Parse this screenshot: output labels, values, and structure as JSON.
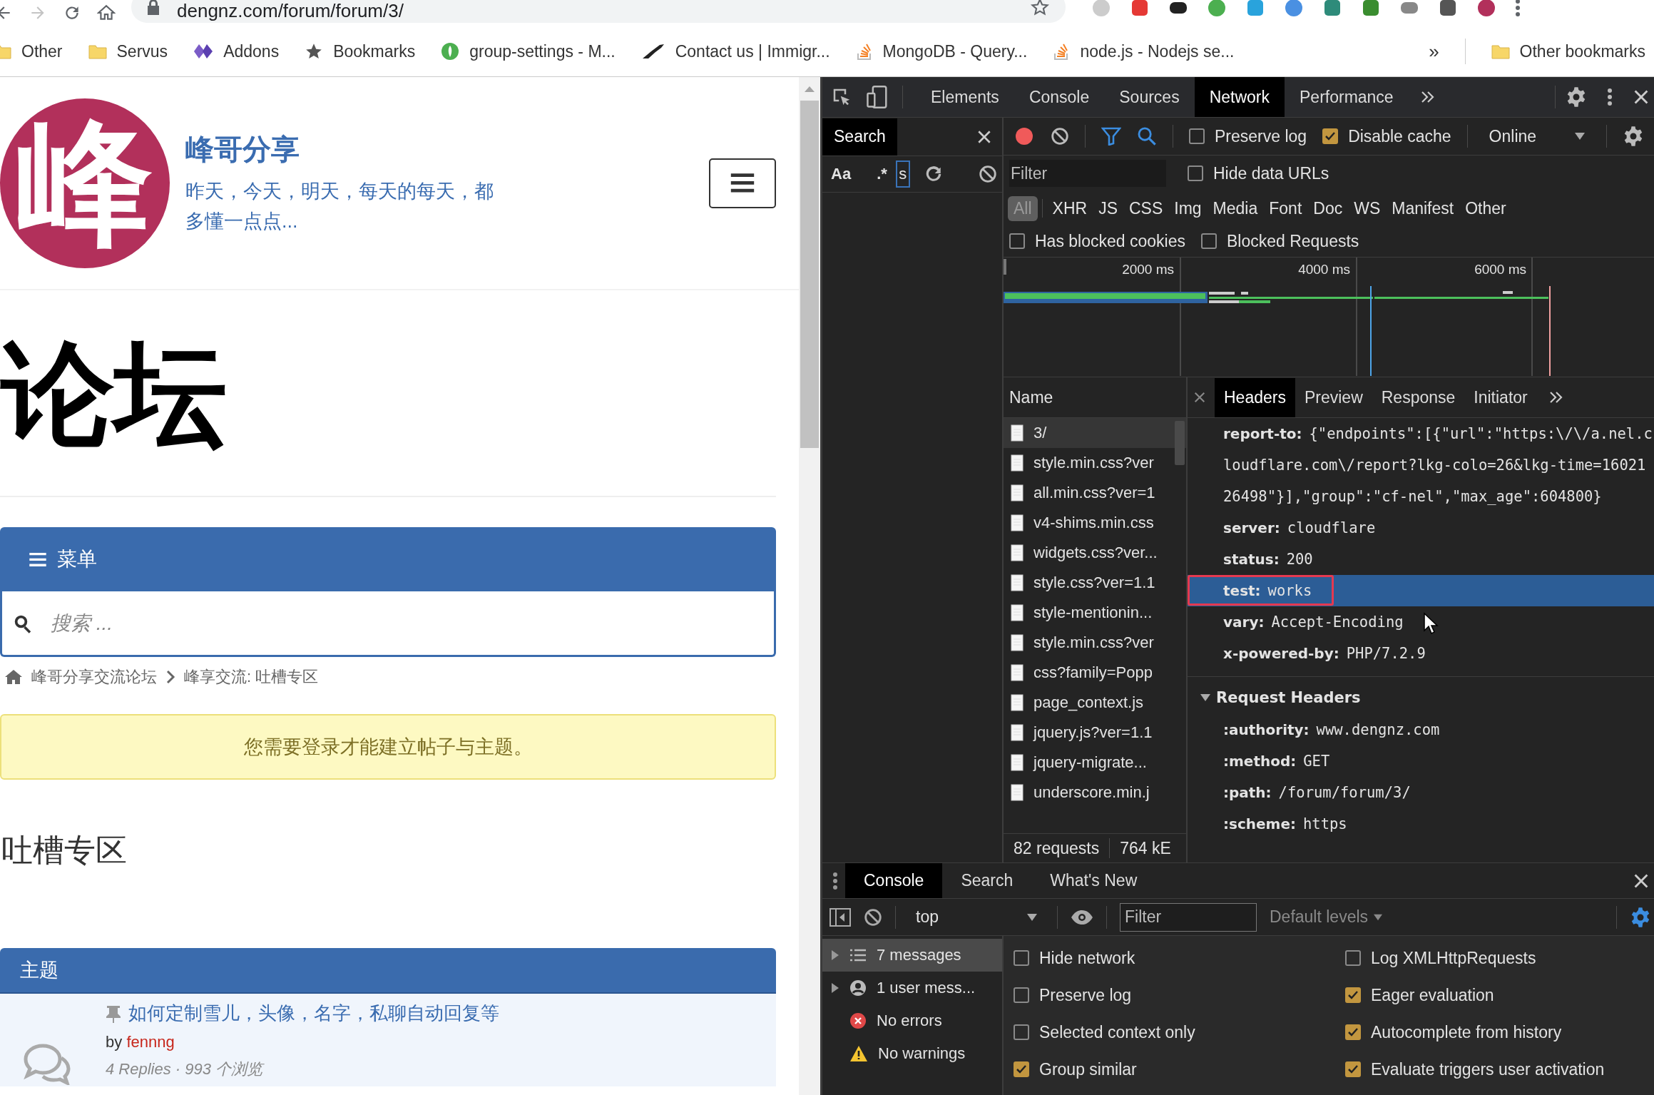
{
  "browser": {
    "url": "dengnz.com/forum/forum/3/",
    "bookmarks": [
      {
        "label": "Other"
      },
      {
        "label": "Servus"
      },
      {
        "label": "Addons"
      },
      {
        "label": "Bookmarks"
      },
      {
        "label": "group-settings - M..."
      },
      {
        "label": "Contact us | Immigr..."
      },
      {
        "label": "MongoDB - Query..."
      },
      {
        "label": "node.js - Nodejs se..."
      }
    ],
    "more": "»",
    "other_bookmarks": "Other bookmarks"
  },
  "page": {
    "logo": "峰",
    "site_title": "峰哥分享",
    "tagline": "昨天，今天，明天，每天的每天，都多懂一点点...",
    "heading": "论坛",
    "menu_label": "菜单",
    "search_placeholder": "搜索 ...",
    "breadcrumbs": [
      "峰哥分享交流论坛",
      "峰享交流: 吐槽专区"
    ],
    "notice": "您需要登录才能建立帖子与主题。",
    "forum_title": "吐槽专区",
    "topics_header": "主题",
    "topics": [
      {
        "title": "如何定制雪儿，头像，名字，私聊自动回复等",
        "pinned": true,
        "by": "by",
        "author": "fennng",
        "meta": "4 Replies · 993 个浏览"
      }
    ]
  },
  "devtools": {
    "tabs": [
      {
        "label": "Elements",
        "selected": false
      },
      {
        "label": "Console",
        "selected": false
      },
      {
        "label": "Sources",
        "selected": false
      },
      {
        "label": "Network",
        "selected": true
      },
      {
        "label": "Performance",
        "selected": false
      }
    ],
    "search_panel": {
      "title": "Search",
      "match_case": "Aa",
      "regex": ".*",
      "query": "s"
    },
    "network": {
      "preserve_log": false,
      "preserve_log_label": "Preserve log",
      "disable_cache": true,
      "disable_cache_label": "Disable cache",
      "throttle": "Online",
      "filter_placeholder": "Filter",
      "hide_data_urls": false,
      "hide_data_urls_label": "Hide data URLs",
      "types": [
        {
          "label": "All",
          "selected": true
        },
        {
          "label": "XHR",
          "selected": false
        },
        {
          "label": "JS",
          "selected": false
        },
        {
          "label": "CSS",
          "selected": false
        },
        {
          "label": "Img",
          "selected": false
        },
        {
          "label": "Media",
          "selected": false
        },
        {
          "label": "Font",
          "selected": false
        },
        {
          "label": "Doc",
          "selected": false
        },
        {
          "label": "WS",
          "selected": false
        },
        {
          "label": "Manifest",
          "selected": false
        },
        {
          "label": "Other",
          "selected": false
        }
      ],
      "has_blocked_cookies": false,
      "has_blocked_cookies_label": "Has blocked cookies",
      "blocked_requests": false,
      "blocked_requests_label": "Blocked Requests",
      "timeline_ticks": [
        "2000 ms",
        "4000 ms",
        "6000 ms"
      ],
      "requests_header": "Name",
      "requests": [
        {
          "name": "3/",
          "selected": true
        },
        {
          "name": "style.min.css?ver",
          "selected": false
        },
        {
          "name": "all.min.css?ver=1",
          "selected": false
        },
        {
          "name": "v4-shims.min.css",
          "selected": false
        },
        {
          "name": "widgets.css?ver...",
          "selected": false
        },
        {
          "name": "style.css?ver=1.1",
          "selected": false
        },
        {
          "name": "style-mentionin...",
          "selected": false
        },
        {
          "name": "style.min.css?ver",
          "selected": false
        },
        {
          "name": "css?family=Popp",
          "selected": false
        },
        {
          "name": "page_context.js",
          "selected": false
        },
        {
          "name": "jquery.js?ver=1.1",
          "selected": false
        },
        {
          "name": "jquery-migrate...",
          "selected": false
        },
        {
          "name": "underscore.min.j",
          "selected": false
        }
      ],
      "summary": [
        "82 requests",
        "764 kE"
      ],
      "detail_tabs": [
        {
          "label": "Headers",
          "selected": true
        },
        {
          "label": "Preview",
          "selected": false
        },
        {
          "label": "Response",
          "selected": false
        },
        {
          "label": "Initiator",
          "selected": false
        }
      ],
      "response_headers": [
        {
          "name": "report-to:",
          "value": "{\"endpoints\":[{\"url\":\"https:\\/\\/a.nel.cloudflare.com\\/report?lkg-colo=26&lkg-time=1602126498\"}],\"group\":\"cf-nel\",\"max_age\":604800}",
          "selected": false,
          "annotated": false
        },
        {
          "name": "server:",
          "value": "cloudflare",
          "selected": false,
          "annotated": false
        },
        {
          "name": "status:",
          "value": "200",
          "selected": false,
          "annotated": false
        },
        {
          "name": "test:",
          "value": "works",
          "selected": true,
          "annotated": true
        },
        {
          "name": "vary:",
          "value": "Accept-Encoding",
          "selected": false,
          "annotated": false
        },
        {
          "name": "x-powered-by:",
          "value": "PHP/7.2.9",
          "selected": false,
          "annotated": false
        }
      ],
      "request_headers": {
        "title": "Request Headers",
        "expanded": true,
        "rows": [
          {
            "name": ":authority:",
            "value": "www.dengnz.com"
          },
          {
            "name": ":method:",
            "value": "GET"
          },
          {
            "name": ":path:",
            "value": "/forum/forum/3/"
          },
          {
            "name": ":scheme:",
            "value": "https"
          }
        ]
      }
    }
  },
  "drawer": {
    "tabs": [
      {
        "label": "Console",
        "selected": true
      },
      {
        "label": "Search",
        "selected": false
      },
      {
        "label": "What's New",
        "selected": false
      }
    ],
    "context": "top",
    "filter_placeholder": "Filter",
    "levels": "Default levels",
    "sidebar": [
      {
        "label": "7 messages",
        "selected": true
      },
      {
        "label": "1 user mess...",
        "selected": false
      },
      {
        "label": "No errors",
        "selected": false
      },
      {
        "label": "No warnings",
        "selected": false
      }
    ],
    "settings": [
      {
        "label": "Hide network",
        "checked": false
      },
      {
        "label": "Log XMLHttpRequests",
        "checked": false
      },
      {
        "label": "Preserve log",
        "checked": false
      },
      {
        "label": "Eager evaluation",
        "checked": true
      },
      {
        "label": "Selected context only",
        "checked": false
      },
      {
        "label": "Autocomplete from history",
        "checked": true
      },
      {
        "label": "Group similar",
        "checked": true
      },
      {
        "label": "Evaluate triggers user activation",
        "checked": true
      }
    ]
  }
}
